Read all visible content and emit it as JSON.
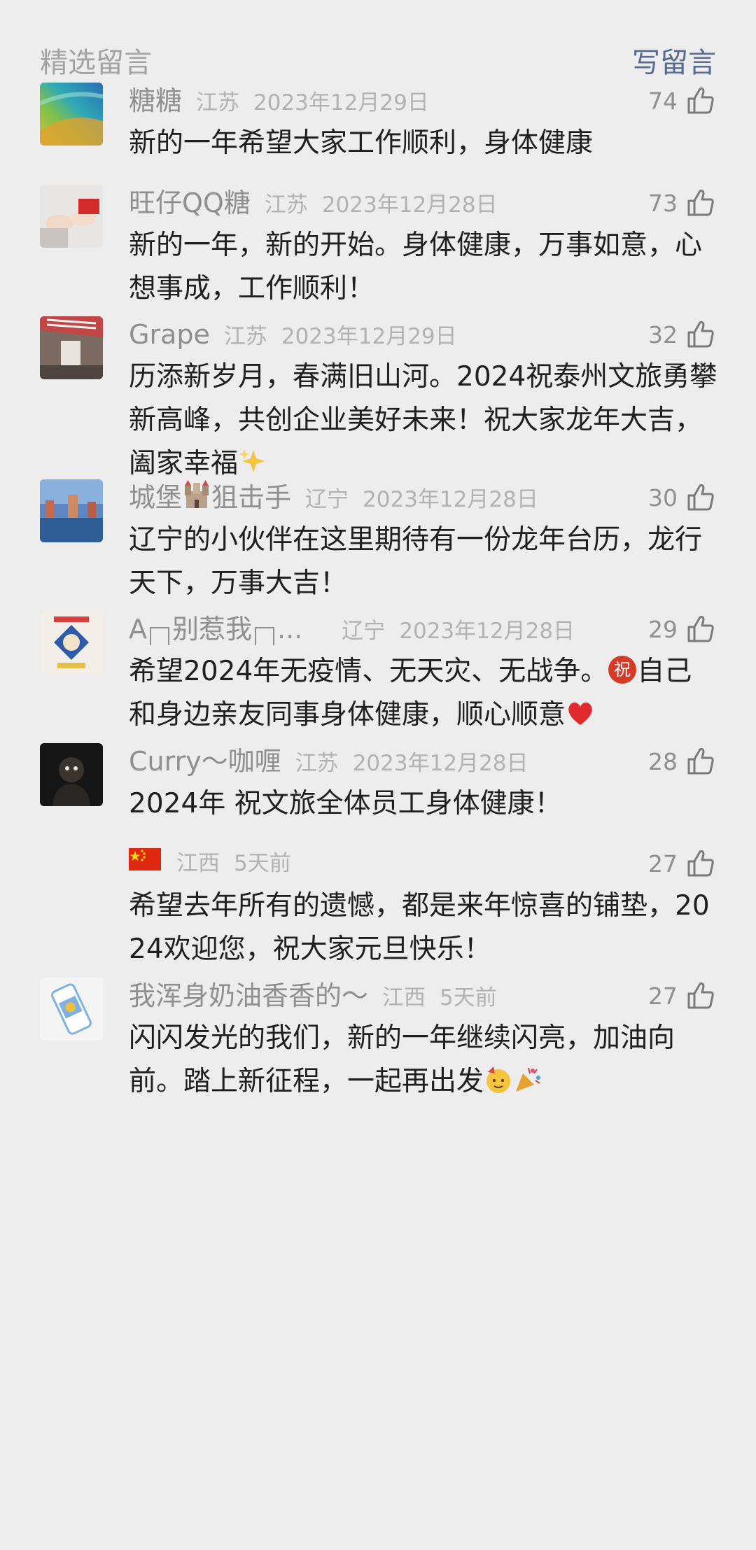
{
  "header": {
    "title": "精选留言",
    "write_label": "写留言"
  },
  "comments": [
    {
      "nick": "糖糖",
      "loc": "江苏",
      "date": "2023年12月29日",
      "likes": "74",
      "text": "新的一年希望大家工作顺利，身体健康"
    },
    {
      "nick": "旺仔QQ糖",
      "loc": "江苏",
      "date": "2023年12月28日",
      "likes": "73",
      "text": "新的一年，新的开始。身体健康，万事如意，心想事成，工作顺利！"
    },
    {
      "nick": "Grape",
      "loc": "江苏",
      "date": "2023年12月29日",
      "likes": "32",
      "text": "历添新岁月，春满旧山河。2024祝泰州文旅勇攀新高峰，共创企业美好未来！祝大家龙年大吉，阖家幸福",
      "emoji": "sparkles-icon"
    },
    {
      "nick_a": "城堡",
      "nick_b": "狙击手",
      "loc": "辽宁",
      "date": "2023年12月28日",
      "likes": "30",
      "text": "辽宁的小伙伴在这里期待有一份龙年台历，龙行天下，万事大吉！"
    },
    {
      "nick_a": "A",
      "nick_b": "别惹我",
      "nick_c": "...",
      "loc": "辽宁",
      "date": "2023年12月28日",
      "likes": "29",
      "text_a": "希望2024年无疫情、无天灾、无战争。",
      "text_b": "自己和身边亲友同事身体健康，顺心顺意",
      "badge": "祝"
    },
    {
      "nick": "Curry～咖喱",
      "loc": "江苏",
      "date": "2023年12月28日",
      "likes": "28",
      "text": "2024年 祝文旅全体员工身体健康！"
    },
    {
      "loc": "江西",
      "date": "5天前",
      "likes": "27",
      "text": "希望去年所有的遗憾，都是来年惊喜的铺垫，2024欢迎您，祝大家元旦快乐！"
    },
    {
      "nick": "我浑身奶油香香的～",
      "loc": "江西",
      "date": "5天前",
      "likes": "27",
      "text": "闪闪发光的我们，新的一年继续闪亮，加油向前。踏上新征程，一起再出发"
    }
  ],
  "colors": {
    "accent": "#576b95",
    "background": "#ededed",
    "meta": "#8f8f8f",
    "text": "#1f1f1f"
  }
}
